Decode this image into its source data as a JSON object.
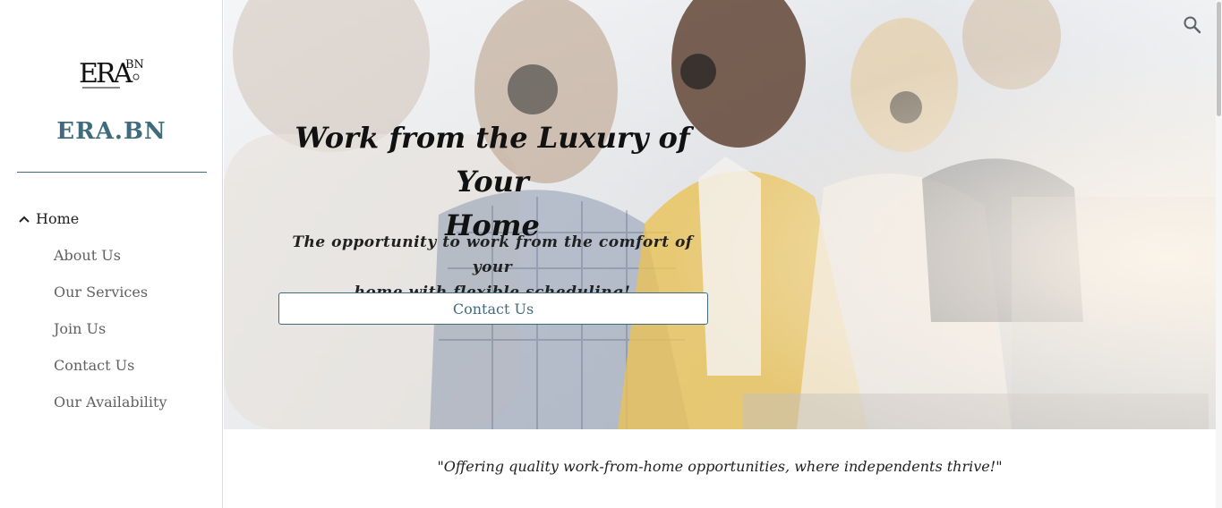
{
  "site": {
    "logo_alt": "ERA BN",
    "name": "ERA.BN"
  },
  "nav": {
    "home": "Home",
    "items": [
      "About Us",
      "Our Services",
      "Join Us",
      "Contact Us",
      "Our Availability"
    ]
  },
  "hero": {
    "title_line1": "Work from the Luxury of Your",
    "title_line2": "Home",
    "subtitle_line1": "The opportunity to work from the comfort of your",
    "subtitle_line2": "home with flexible scheduling!",
    "button_label": "Contact Us"
  },
  "tagline": "\"Offering quality work-from-home opportunities, where independents thrive!\"",
  "icons": {
    "search": "search-icon",
    "chevron": "chevron-up-icon"
  },
  "colors": {
    "accent": "#3f6b7c",
    "text": "#212121",
    "nav_text": "#616161"
  }
}
